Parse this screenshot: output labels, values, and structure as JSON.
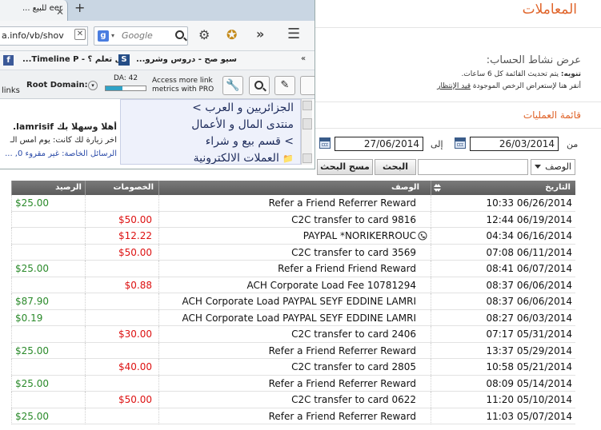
{
  "page": {
    "title": "المعاملات",
    "subtitle": "عرض نشاط الحساب:",
    "note_bold": "تنويه:",
    "note_text": "يتم تحديث القائمة كل 6 ساعات.",
    "note2_prefix": "أنقر هنا لإستعراض الرخص الموجودة",
    "note2_link": "قيد الإنتظار",
    "section_title": "قائمة العمليات"
  },
  "filter": {
    "from_label": "من",
    "to_label": "إلى",
    "from_date": "26/03/2014",
    "to_date": "27/06/2014",
    "field_select": "الوصف",
    "search_value": "",
    "search_button": "البحث",
    "clear_button": "مسح البحث"
  },
  "table": {
    "headers": {
      "date": "التاريخ",
      "desc": "الوصف",
      "debit": "الخصومات",
      "balance": "الرصيد"
    },
    "rows": [
      {
        "date": "10:33 06/26/2014",
        "desc": "Refer a Friend Referrer Reward",
        "debit": "",
        "balance": "$25.00",
        "phone": false
      },
      {
        "date": "12:44 06/19/2014",
        "desc": "C2C transfer to card 9816",
        "debit": "$50.00",
        "balance": "",
        "phone": false
      },
      {
        "date": "04:34 06/16/2014",
        "desc": "PAYPAL *NORIKERROUC",
        "debit": "$12.22",
        "balance": "",
        "phone": true
      },
      {
        "date": "07:08 06/11/2014",
        "desc": "C2C transfer to card 3569",
        "debit": "$50.00",
        "balance": "",
        "phone": false
      },
      {
        "date": "08:41 06/07/2014",
        "desc": "Refer a Friend Friend Reward",
        "debit": "",
        "balance": "$25.00",
        "phone": false
      },
      {
        "date": "08:37 06/06/2014",
        "desc": "ACH Corporate Load Fee 10781294",
        "debit": "$0.88",
        "balance": "",
        "phone": false
      },
      {
        "date": "08:37 06/06/2014",
        "desc": "ACH Corporate Load PAYPAL SEYF EDDINE LAMRI",
        "debit": "",
        "balance": "$87.90",
        "phone": false
      },
      {
        "date": "08:27 06/03/2014",
        "desc": "ACH Corporate Load PAYPAL SEYF EDDINE LAMRI",
        "debit": "",
        "balance": "$0.19",
        "phone": false
      },
      {
        "date": "07:17 05/31/2014",
        "desc": "C2C transfer to card 2406",
        "debit": "$30.00",
        "balance": "",
        "phone": false
      },
      {
        "date": "13:37 05/29/2014",
        "desc": "Refer a Friend Referrer Reward",
        "debit": "",
        "balance": "$25.00",
        "phone": false
      },
      {
        "date": "10:58 05/21/2014",
        "desc": "C2C transfer to card 2805",
        "debit": "$40.00",
        "balance": "",
        "phone": false
      },
      {
        "date": "08:09 05/14/2014",
        "desc": "Refer a Friend Referrer Reward",
        "debit": "",
        "balance": "$25.00",
        "phone": false
      },
      {
        "date": "11:20 05/10/2014",
        "desc": "C2C transfer to card 0622",
        "debit": "$50.00",
        "balance": "",
        "phone": false
      },
      {
        "date": "11:03 05/07/2014",
        "desc": "Refer a Friend Referrer Reward",
        "debit": "",
        "balance": "$25.00",
        "phone": false
      }
    ]
  },
  "browser": {
    "tab_title": "eer للبيع ...",
    "url": "a.info/vb/shov",
    "search_placeholder": "Google",
    "bookmarks": [
      "هل تعلم ؟ - Timeline P...",
      "سيو صح - دروس وشرو..."
    ],
    "moz_links": "links",
    "root_domain_label": "Root Domain:",
    "da_label": "DA: 42",
    "moz_promo": "Access more link metrics with PRO",
    "forum_lines": [
      "الجزائريين و العرب >",
      "منتدى المال و الأعمال",
      "> قسم بيع و شراء",
      "العملات الالكترونية"
    ],
    "welcome": "أهلا وسهلا بك lamrisif.",
    "last_visit": "آخر زيارة لك كانت: يوم أمس الـ",
    "private_msgs": "الرسائل الخاصة: غير مقروء 0, ..."
  },
  "colors": {
    "accent": "#e0642a",
    "credit": "#2a8a2a",
    "debit": "#d11111"
  }
}
